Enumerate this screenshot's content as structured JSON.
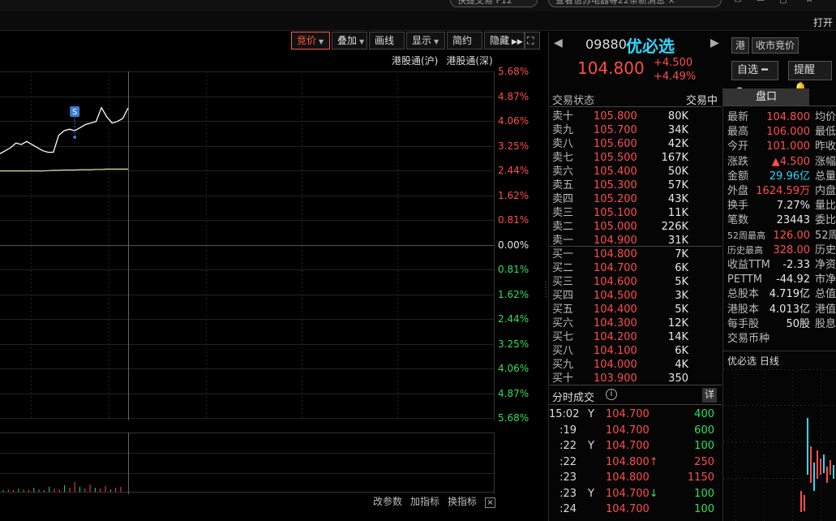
{
  "topbar": {
    "pill1": "快捷交易 F12",
    "pill2": "查看信苏电器等22条新消息 ×",
    "open_label": "打开"
  },
  "chart_toolbar": {
    "bid_auction": "竞价",
    "overlay": "叠加",
    "draw": "画线",
    "display": "显示",
    "simple": "简约",
    "hide": "隐藏"
  },
  "hk_links": {
    "sh": "港股通(沪)",
    "sz": "港股通(深)"
  },
  "chart_data": {
    "type": "line",
    "ylim": [
      -5.68,
      5.68
    ],
    "y_tick_labels": [
      "5.68%",
      "4.87%",
      "4.06%",
      "3.25%",
      "2.44%",
      "1.62%",
      "0.81%",
      "0.00%",
      "0.81%",
      "1.62%",
      "2.44%",
      "3.25%",
      "4.06%",
      "4.87%",
      "5.68%"
    ],
    "series": [
      {
        "values": [
          3.0,
          3.1,
          3.2,
          3.35,
          3.3,
          3.4,
          3.3,
          3.2,
          3.1,
          3.05,
          3.05,
          3.6,
          3.75,
          3.8,
          3.75,
          3.85,
          3.95,
          4.0,
          4.05,
          4.5,
          4.2,
          4.0,
          4.05,
          4.15,
          4.49
        ],
        "color": "#ffffff"
      },
      {
        "values": [
          2.44,
          2.44,
          2.44,
          2.44,
          2.44,
          2.44,
          2.44,
          2.44,
          2.44,
          2.45,
          2.46,
          2.46,
          2.47,
          2.47,
          2.47,
          2.48,
          2.48,
          2.48,
          2.49,
          2.49,
          2.5,
          2.5,
          2.5,
          2.5,
          2.5
        ],
        "color": "#e8e0a0"
      }
    ],
    "marker": "S"
  },
  "bottom_links": {
    "params": "改参数",
    "indicator": "加指标",
    "switch": "换指标",
    "close": "×"
  },
  "quote": {
    "code": "09880",
    "name": "优必选",
    "tag_hk": "港",
    "tag_auction": "收市竞价",
    "price": "104.800",
    "chg_abs": "+4.500",
    "chg_pct": "+4.49%",
    "watch_label": "自选",
    "alert_label": "提醒",
    "trade_status_label": "交易状态",
    "trade_status": "交易中"
  },
  "orderbook": {
    "asks": [
      {
        "label": "卖十",
        "price": "105.800",
        "vol": "80K"
      },
      {
        "label": "卖九",
        "price": "105.700",
        "vol": "34K"
      },
      {
        "label": "卖八",
        "price": "105.600",
        "vol": "42K"
      },
      {
        "label": "卖七",
        "price": "105.500",
        "vol": "167K"
      },
      {
        "label": "卖六",
        "price": "105.400",
        "vol": "50K"
      },
      {
        "label": "卖五",
        "price": "105.300",
        "vol": "57K"
      },
      {
        "label": "卖四",
        "price": "105.200",
        "vol": "43K"
      },
      {
        "label": "卖三",
        "price": "105.100",
        "vol": "11K"
      },
      {
        "label": "卖二",
        "price": "105.000",
        "vol": "226K"
      },
      {
        "label": "卖一",
        "price": "104.900",
        "vol": "31K"
      }
    ],
    "bids": [
      {
        "label": "买一",
        "price": "104.800",
        "vol": "7K"
      },
      {
        "label": "买二",
        "price": "104.700",
        "vol": "6K"
      },
      {
        "label": "买三",
        "price": "104.600",
        "vol": "5K"
      },
      {
        "label": "买四",
        "price": "104.500",
        "vol": "3K"
      },
      {
        "label": "买五",
        "price": "104.400",
        "vol": "5K"
      },
      {
        "label": "买六",
        "price": "104.300",
        "vol": "12K"
      },
      {
        "label": "买七",
        "price": "104.200",
        "vol": "14K"
      },
      {
        "label": "买八",
        "price": "104.100",
        "vol": "6K"
      },
      {
        "label": "买九",
        "price": "104.000",
        "vol": "4K"
      },
      {
        "label": "买十",
        "price": "103.900",
        "vol": "350"
      }
    ]
  },
  "tape": {
    "title": "分时成交",
    "info": "i",
    "detail": "详",
    "rows": [
      {
        "time": "15:02",
        "flag": "Y",
        "price": "104.700",
        "arrow": "",
        "vol": "400",
        "color": "green"
      },
      {
        "time": ":19",
        "flag": "",
        "price": "104.700",
        "arrow": "",
        "vol": "600",
        "color": "green"
      },
      {
        "time": ":22",
        "flag": "Y",
        "price": "104.700",
        "arrow": "",
        "vol": "100",
        "color": "green"
      },
      {
        "time": ":22",
        "flag": "",
        "price": "104.800",
        "arrow": "↑",
        "vol": "250",
        "color": "red"
      },
      {
        "time": ":23",
        "flag": "",
        "price": "104.800",
        "arrow": "",
        "vol": "1150",
        "color": "red"
      },
      {
        "time": ":23",
        "flag": "Y",
        "price": "104.700",
        "arrow": "↓",
        "vol": "100",
        "color": "green"
      },
      {
        "time": ":24",
        "flag": "",
        "price": "104.700",
        "arrow": "",
        "vol": "100",
        "color": "green"
      }
    ]
  },
  "pankou": {
    "tab": "盘口",
    "rows": [
      {
        "k": "最新",
        "v": "104.800",
        "c": "red",
        "k2": "均价"
      },
      {
        "k": "最高",
        "v": "106.000",
        "c": "red",
        "k2": "最低"
      },
      {
        "k": "今开",
        "v": "101.000",
        "c": "red",
        "k2": "昨收"
      },
      {
        "k": "涨跌",
        "v": "▲4.500",
        "c": "red",
        "k2": "涨幅"
      },
      {
        "k": "金额",
        "v": "29.96亿",
        "c": "cyan",
        "k2": "总量"
      },
      {
        "k": "外盘",
        "v": "1624.59万",
        "c": "red",
        "k2": "内盘"
      },
      {
        "k": "换手",
        "v": "7.27%",
        "c": "white",
        "k2": "量比"
      },
      {
        "k": "笔数",
        "v": "23443",
        "c": "white",
        "k2": "委比"
      },
      {
        "k": "52周最高",
        "v": "126.00",
        "c": "red",
        "k2": "52周",
        "sm": true
      },
      {
        "k": "历史最高",
        "v": "328.00",
        "c": "red",
        "k2": "历史",
        "sm": true
      },
      {
        "k": "收益TTM",
        "v": "-2.33",
        "c": "white",
        "k2": "净资"
      },
      {
        "k": "PETTM",
        "v": "-44.92",
        "c": "white",
        "k2": "市净"
      },
      {
        "k": "总股本",
        "v": "4.719亿",
        "c": "white",
        "k2": "总值"
      },
      {
        "k": "港股本",
        "v": "4.013亿",
        "c": "white",
        "k2": "港值"
      },
      {
        "k": "每手股",
        "v": "50股",
        "c": "white",
        "k2": "股息"
      },
      {
        "k": "交易币种",
        "v": "",
        "c": "white",
        "k2": ""
      }
    ],
    "kline_title": "优必选 日线"
  }
}
